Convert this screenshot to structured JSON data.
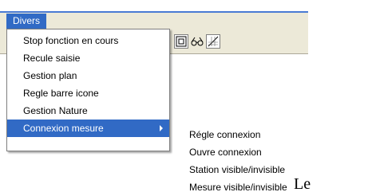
{
  "menubar": {
    "active_menu": "Divers"
  },
  "toolbar": {
    "icons": [
      "frame-icon",
      "glasses-icon",
      "chart-icon"
    ]
  },
  "dropdown": {
    "items": [
      {
        "label": "Stop fonction en cours"
      },
      {
        "label": "Recule saisie"
      },
      {
        "label": "Gestion plan"
      },
      {
        "label": "Regle barre icone"
      },
      {
        "label": "Gestion Nature"
      },
      {
        "label": "Connexion mesure",
        "has_submenu": true,
        "highlighted": true
      }
    ]
  },
  "submenu": {
    "items": [
      {
        "label": "Régle connexion"
      },
      {
        "label": "Ouvre connexion"
      },
      {
        "label": "Station visible/invisible"
      },
      {
        "label": "Mesure visible/invisible"
      }
    ]
  },
  "page": {
    "trailing_text": "Le"
  },
  "colors": {
    "highlight": "#316ac5",
    "menubar_bg": "#ece9d8",
    "accent_line": "#4a7bd4"
  }
}
